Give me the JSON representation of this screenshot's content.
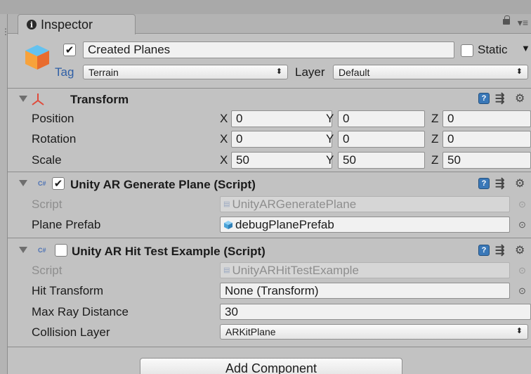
{
  "window": {
    "tab_title": "Inspector"
  },
  "object": {
    "active": true,
    "name": "Created Planes",
    "static_label": "Static",
    "static_checked": false,
    "tag_label": "Tag",
    "tag_value": "Terrain",
    "layer_label": "Layer",
    "layer_value": "Default"
  },
  "transform": {
    "title": "Transform",
    "rows": [
      {
        "label": "Position",
        "x": "0",
        "y": "0",
        "z": "0"
      },
      {
        "label": "Rotation",
        "x": "0",
        "y": "0",
        "z": "0"
      },
      {
        "label": "Scale",
        "x": "50",
        "y": "50",
        "z": "50"
      }
    ],
    "axis_x": "X",
    "axis_y": "Y",
    "axis_z": "Z"
  },
  "generate_plane": {
    "enabled": true,
    "title": "Unity AR Generate Plane (Script)",
    "script_label": "Script",
    "script_value": "UnityARGeneratePlane",
    "prefab_label": "Plane Prefab",
    "prefab_value": "debugPlanePrefab"
  },
  "hit_test": {
    "enabled": false,
    "title": "Unity AR Hit Test Example (Script)",
    "script_label": "Script",
    "script_value": "UnityARHitTestExample",
    "hit_transform_label": "Hit Transform",
    "hit_transform_value": "None (Transform)",
    "max_ray_label": "Max Ray Distance",
    "max_ray_value": "30",
    "collision_label": "Collision Layer",
    "collision_value": "ARKitPlane"
  },
  "add_component_label": "Add Component",
  "colors": {
    "help_blue": "#3a78b8",
    "cs_blue": "#4a71b5",
    "panel_bg": "#c2c2c2"
  }
}
